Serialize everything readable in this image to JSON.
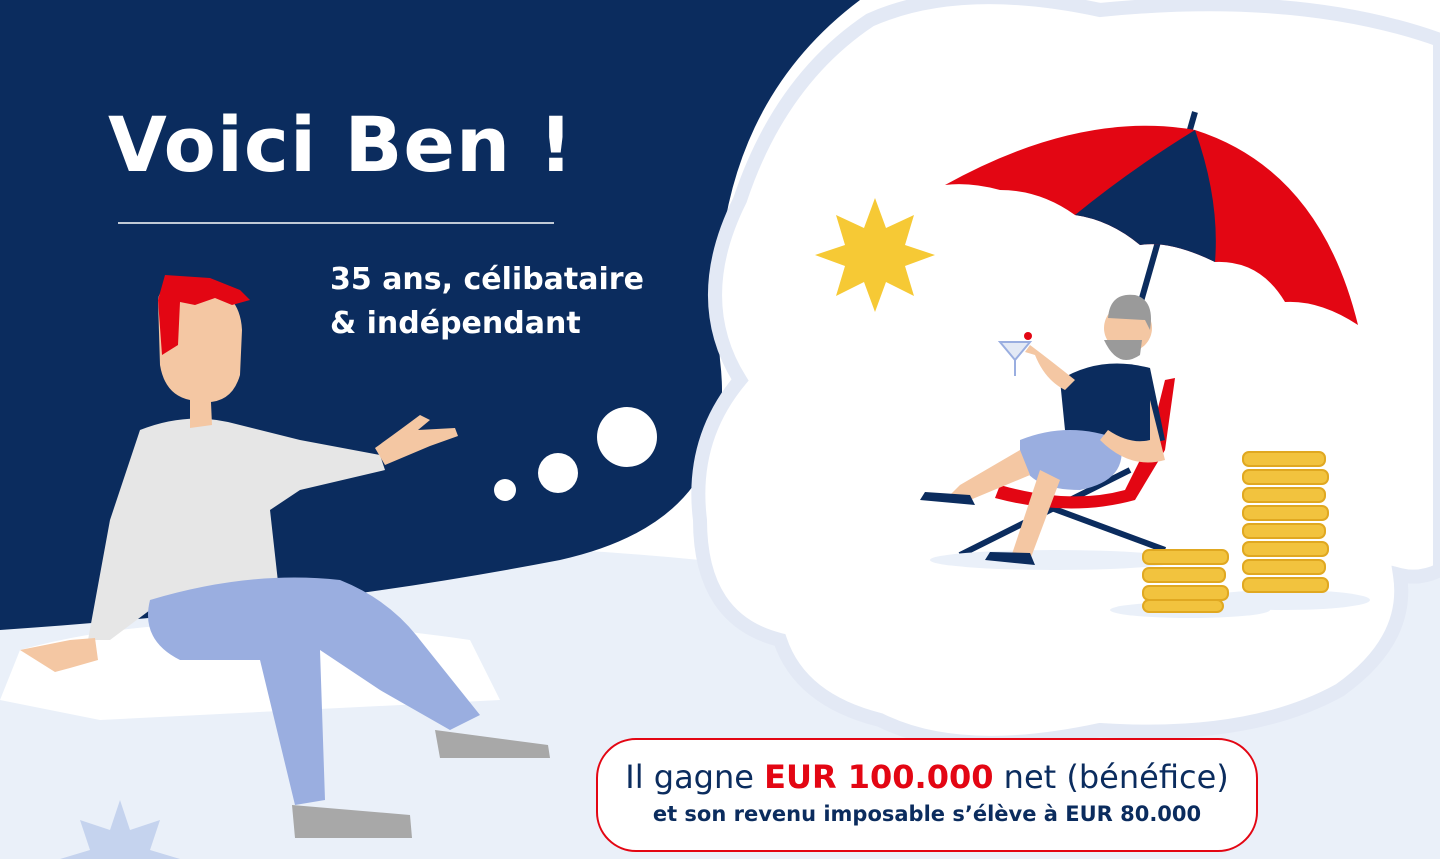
{
  "colors": {
    "navy": "#0b2c5e",
    "accent_red": "#e30613",
    "sun_yellow": "#f6c935",
    "coin_gold": "#f2c33e",
    "trousers_blue": "#9aaee0",
    "light_blue_bg": "#e9eef8"
  },
  "headline": "Voici Ben !",
  "subtitle": {
    "line1": "35 ans, célibataire",
    "line2": "& indépendant"
  },
  "info": {
    "prefix": "Il gagne ",
    "amount": "EUR 100.000",
    "suffix": " net (bénéfice)",
    "line2": "et son revenu imposable s’élève à EUR 80.000"
  },
  "illustration": {
    "icons": [
      "sun-icon",
      "beach-umbrella-icon",
      "coin-stack-icon",
      "cocktail-glass-icon",
      "thought-bubble-icon",
      "deck-chair-icon"
    ]
  }
}
